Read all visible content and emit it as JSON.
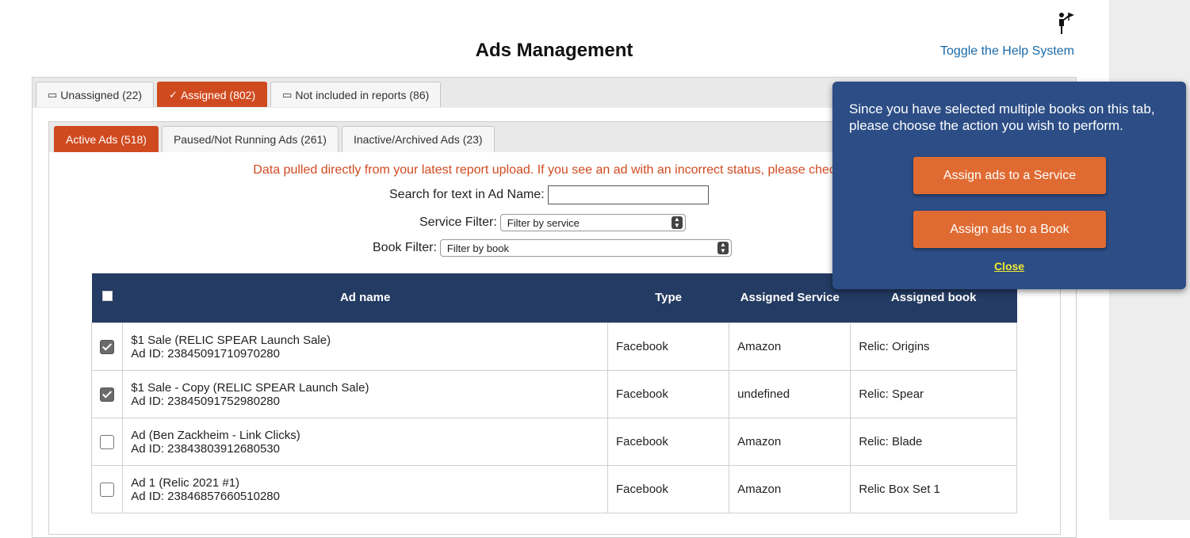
{
  "help": {
    "link": "Toggle the Help System",
    "icon": "help-figure-icon"
  },
  "page_title": "Ads Management",
  "outer_tabs": [
    {
      "label": "Unassigned (22)",
      "icon": "inbox-icon",
      "active": false
    },
    {
      "label": "Assigned (802)",
      "icon": "check-circle-icon",
      "active": true
    },
    {
      "label": "Not included in reports (86)",
      "icon": "inbox-icon",
      "active": false
    }
  ],
  "inner_tabs": [
    {
      "label": "Active Ads (518)",
      "active": true
    },
    {
      "label": "Paused/Not Running Ads (261)",
      "active": false
    },
    {
      "label": "Inactive/Archived Ads (23)",
      "active": false
    }
  ],
  "notice": "Data pulled directly from your latest report upload. If you see an ad with an incorrect status, please check th",
  "filters": {
    "search_label": "Search for text in Ad Name:",
    "search_value": "",
    "service_label": "Service Filter:",
    "service_value": "Filter by service",
    "book_label": "Book Filter:",
    "book_value": "Filter by book"
  },
  "table": {
    "headers": {
      "ad_name": "Ad name",
      "type": "Type",
      "service": "Assigned Service",
      "book": "Assigned book"
    },
    "rows": [
      {
        "checked": true,
        "name": "$1 Sale (RELIC SPEAR Launch Sale)",
        "ad_id": "Ad ID: 23845091710970280",
        "type": "Facebook",
        "service": "Amazon",
        "book": "Relic: Origins"
      },
      {
        "checked": true,
        "name": "$1 Sale - Copy (RELIC SPEAR Launch Sale)",
        "ad_id": "Ad ID: 23845091752980280",
        "type": "Facebook",
        "service": "undefined",
        "book": "Relic: Spear"
      },
      {
        "checked": false,
        "name": "Ad (Ben Zackheim - Link Clicks)",
        "ad_id": "Ad ID: 23843803912680530",
        "type": "Facebook",
        "service": "Amazon",
        "book": "Relic: Blade"
      },
      {
        "checked": false,
        "name": "Ad 1 (Relic 2021 #1)",
        "ad_id": "Ad ID: 23846857660510280",
        "type": "Facebook",
        "service": "Amazon",
        "book": "Relic Box Set 1"
      }
    ]
  },
  "popup": {
    "message": "Since you have selected multiple books on this tab, please choose the action you wish to perform.",
    "assign_service": "Assign ads to a Service",
    "assign_book": "Assign ads to a Book",
    "close": "Close"
  },
  "colors": {
    "accent": "#d04a20",
    "header_navy": "#243b63",
    "popup_bg": "#2c4d85",
    "popup_button": "#e06b32",
    "link": "#1a6aa8"
  }
}
